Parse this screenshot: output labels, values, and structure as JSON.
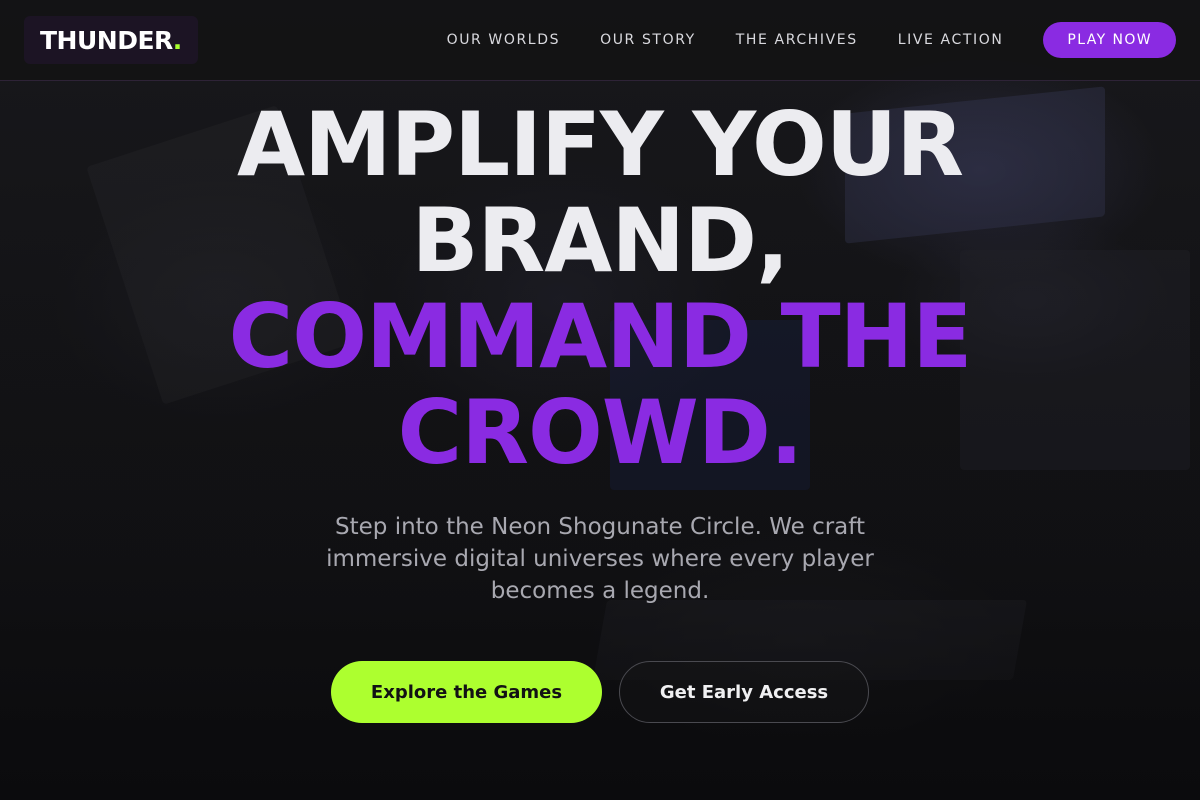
{
  "header": {
    "logo_text": "THUNDER",
    "logo_dot": ".",
    "nav": [
      {
        "label": "OUR WORLDS"
      },
      {
        "label": "OUR STORY"
      },
      {
        "label": "THE ARCHIVES"
      },
      {
        "label": "LIVE ACTION"
      }
    ],
    "play_label": "PLAY NOW"
  },
  "hero": {
    "headline_line1": "AMPLIFY YOUR",
    "headline_line2": "BRAND,",
    "headline_line3": "COMMAND THE",
    "headline_line4": "CROWD.",
    "subtext": "Step into the Neon Shogunate Circle. We craft immersive digital universes where every player becomes a legend.",
    "primary_cta": "Explore the Games",
    "secondary_cta": "Get Early Access"
  },
  "colors": {
    "accent_purple": "#8a2be2",
    "accent_lime": "#adff2f",
    "background": "#111113"
  }
}
